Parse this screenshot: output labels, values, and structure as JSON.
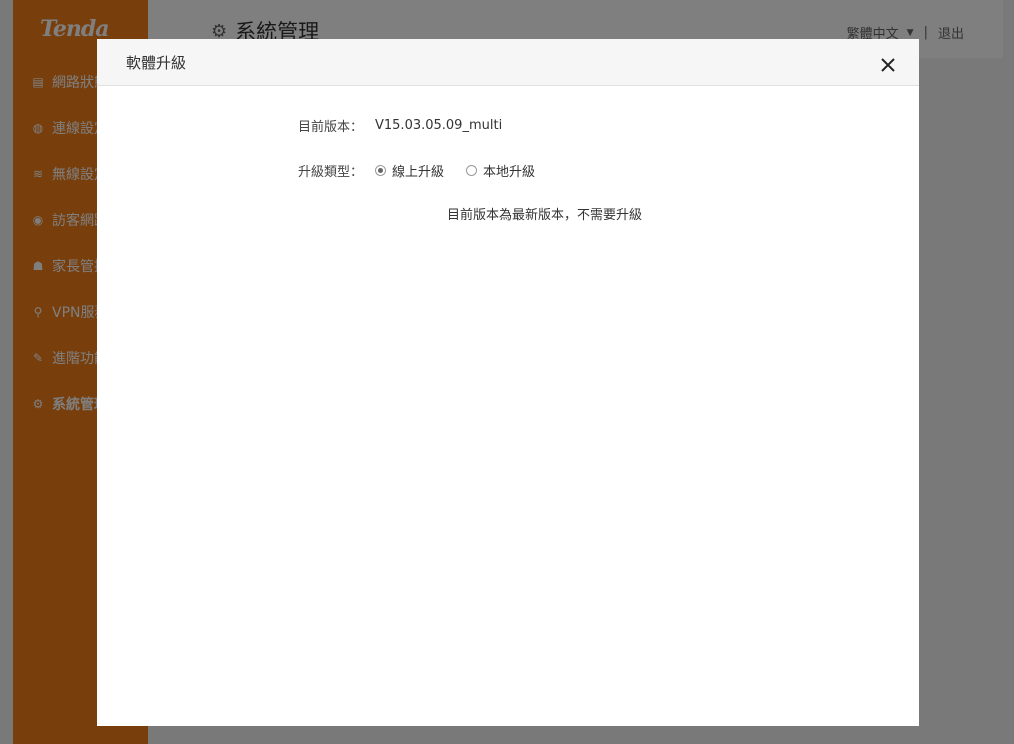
{
  "app": {
    "logo": "Tenda",
    "page_title": "系統管理",
    "language": "繁體中文",
    "logout": "退出",
    "sidebar": [
      {
        "label": "網路狀態",
        "icon": "router-icon"
      },
      {
        "label": "連線設定",
        "icon": "globe-icon"
      },
      {
        "label": "無線設定",
        "icon": "wifi-icon"
      },
      {
        "label": "訪客網路",
        "icon": "location-icon"
      },
      {
        "label": "家長管控",
        "icon": "parental-icon"
      },
      {
        "label": "VPN服務",
        "icon": "vpn-icon"
      },
      {
        "label": "進階功能",
        "icon": "wrench-icon"
      },
      {
        "label": "系統管理",
        "icon": "gear-icon",
        "active": true
      }
    ]
  },
  "modal": {
    "title": "軟體升級",
    "version_label": "目前版本：",
    "version_value": "V15.03.05.09_multi",
    "type_label": "升級類型：",
    "options": [
      {
        "label": "線上升級",
        "selected": true
      },
      {
        "label": "本地升級",
        "selected": false
      }
    ],
    "status_message": "目前版本為最新版本，不需要升級"
  },
  "colors": {
    "brand": "#f07e1a",
    "overlay": "rgba(0,0,0,0.5)"
  }
}
